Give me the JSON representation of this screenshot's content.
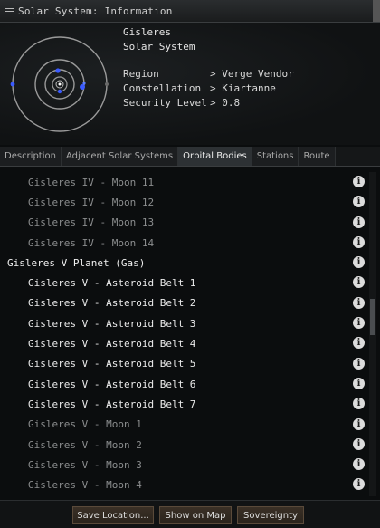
{
  "window": {
    "title": "Solar System: Information"
  },
  "header": {
    "name": "Gisleres",
    "type": "Solar System",
    "fields": [
      {
        "key": "Region",
        "value": "> Verge Vendor"
      },
      {
        "key": "Constellation",
        "value": "> Kiartanne"
      },
      {
        "key": "Security Level",
        "value": "> 0.8"
      }
    ]
  },
  "tabs": [
    {
      "label": "Description"
    },
    {
      "label": "Adjacent Solar Systems"
    },
    {
      "label": "Orbital Bodies",
      "active": true
    },
    {
      "label": "Stations"
    },
    {
      "label": "Route"
    }
  ],
  "orbital_bodies": [
    {
      "label": "Gisleres IV - Moon 11",
      "style": "dim"
    },
    {
      "label": "Gisleres IV - Moon 12",
      "style": "dim"
    },
    {
      "label": "Gisleres IV - Moon 13",
      "style": "dim"
    },
    {
      "label": "Gisleres IV - Moon 14",
      "style": "dim"
    },
    {
      "label": "Gisleres V Planet (Gas)",
      "style": "planet"
    },
    {
      "label": "Gisleres V - Asteroid Belt 1",
      "style": "bright"
    },
    {
      "label": "Gisleres V - Asteroid Belt 2",
      "style": "bright"
    },
    {
      "label": "Gisleres V - Asteroid Belt 3",
      "style": "bright"
    },
    {
      "label": "Gisleres V - Asteroid Belt 4",
      "style": "bright"
    },
    {
      "label": "Gisleres V - Asteroid Belt 5",
      "style": "bright"
    },
    {
      "label": "Gisleres V - Asteroid Belt 6",
      "style": "bright"
    },
    {
      "label": "Gisleres V - Asteroid Belt 7",
      "style": "bright"
    },
    {
      "label": "Gisleres V - Moon 1",
      "style": "dim"
    },
    {
      "label": "Gisleres V - Moon 2",
      "style": "dim"
    },
    {
      "label": "Gisleres V - Moon 3",
      "style": "dim"
    },
    {
      "label": "Gisleres V - Moon 4",
      "style": "dim"
    }
  ],
  "info_icon": "info-icon",
  "footer": {
    "save_location": "Save Location...",
    "show_on_map": "Show on Map",
    "sovereignty": "Sovereignty"
  }
}
